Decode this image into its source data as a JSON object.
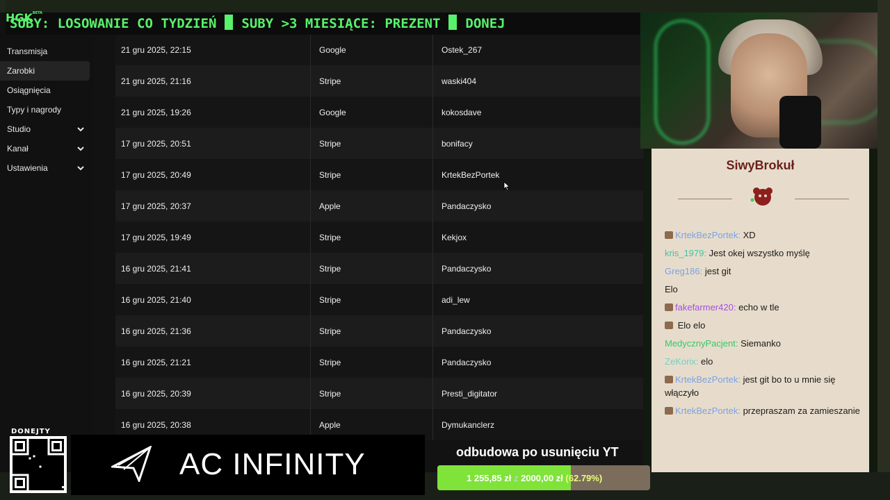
{
  "ticker": {
    "logo": "HGK",
    "logo_badge": "BETA",
    "segment_1": "SUBY: LOSOWANIE CO TYDZIEŃ",
    "segment_2": "SUBY >3 MIESIĄCE: PREZENT",
    "segment_3": "DONEJ"
  },
  "sidebar": {
    "items": [
      {
        "label": "Transmisja"
      },
      {
        "label": "Zarobki",
        "active": true
      },
      {
        "label": "Osiągnięcia"
      },
      {
        "label": "Typy i nagrody"
      },
      {
        "label": "Studio",
        "icon": "chevron-down-icon"
      },
      {
        "label": "Kanał",
        "icon": "chevron-down-icon"
      },
      {
        "label": "Ustawienia",
        "icon": "chevron-down-icon"
      }
    ]
  },
  "table": {
    "rows": [
      {
        "date": "21 gru 2025, 22:15",
        "method": "Google",
        "user": "Ostek_267"
      },
      {
        "date": "21 gru 2025, 21:16",
        "method": "Stripe",
        "user": "waski404"
      },
      {
        "date": "21 gru 2025, 19:26",
        "method": "Google",
        "user": "kokosdave"
      },
      {
        "date": "17 gru 2025, 20:51",
        "method": "Stripe",
        "user": "bonifacy"
      },
      {
        "date": "17 gru 2025, 20:49",
        "method": "Stripe",
        "user": "KrtekBezPortek"
      },
      {
        "date": "17 gru 2025, 20:37",
        "method": "Apple",
        "user": "Pandaczysko"
      },
      {
        "date": "17 gru 2025, 19:49",
        "method": "Stripe",
        "user": "Kekjox"
      },
      {
        "date": "16 gru 2025, 21:41",
        "method": "Stripe",
        "user": "Pandaczysko"
      },
      {
        "date": "16 gru 2025, 21:40",
        "method": "Stripe",
        "user": "adi_lew"
      },
      {
        "date": "16 gru 2025, 21:36",
        "method": "Stripe",
        "user": "Pandaczysko"
      },
      {
        "date": "16 gru 2025, 21:21",
        "method": "Stripe",
        "user": "Pandaczysko"
      },
      {
        "date": "16 gru 2025, 20:39",
        "method": "Stripe",
        "user": "Presti_digitator"
      },
      {
        "date": "16 gru 2025, 20:38",
        "method": "Apple",
        "user": "Dymukanclerz"
      }
    ]
  },
  "chat": {
    "title": "SiwyBrokuł",
    "messages": [
      {
        "user": "KrtekBezPortek:",
        "text": "XD",
        "badge": true,
        "color": "u-blue"
      },
      {
        "user": "kris_1979:",
        "text": "Jest okej wszystko myślę",
        "badge": false,
        "color": "u-teal"
      },
      {
        "user": "Greg186:",
        "text": "jest git",
        "badge": false,
        "color": "u-blue"
      },
      {
        "user": "",
        "text": "Elo",
        "badge": false,
        "color": "u-pink"
      },
      {
        "user": "fakefarmer420:",
        "text": "echo w tle",
        "badge": true,
        "color": "u-purple"
      },
      {
        "user": "",
        "text": "Elo elo",
        "badge": true,
        "color": "u-lteal"
      },
      {
        "user": "MedycznyPacjent:",
        "text": "Siemanko",
        "badge": false,
        "color": "u-green"
      },
      {
        "user": "ZeKorix:",
        "text": "elo",
        "badge": false,
        "color": "u-lteal"
      },
      {
        "user": "KrtekBezPortek:",
        "text": "jest git bo to u mnie się włączyło",
        "badge": true,
        "color": "u-blue"
      },
      {
        "user": "KrtekBezPortek:",
        "text": "przepraszam za zamieszanie",
        "badge": true,
        "color": "u-blue"
      }
    ]
  },
  "qr": {
    "label": "DONEJTY"
  },
  "sponsor": {
    "name": "AC INFINITY"
  },
  "goal": {
    "title": "odbudowa po usunięciu YT",
    "current": "1 255,85 zł",
    "of": "z",
    "target": "2000,00 zł",
    "percent_text": "(62.79%)",
    "progress": 0.6279
  },
  "colors": {
    "ticker_green": "#58f26b",
    "goal_green": "#7fe33a",
    "chat_bg": "#e7dccb",
    "chat_title": "#6a1f1c"
  }
}
